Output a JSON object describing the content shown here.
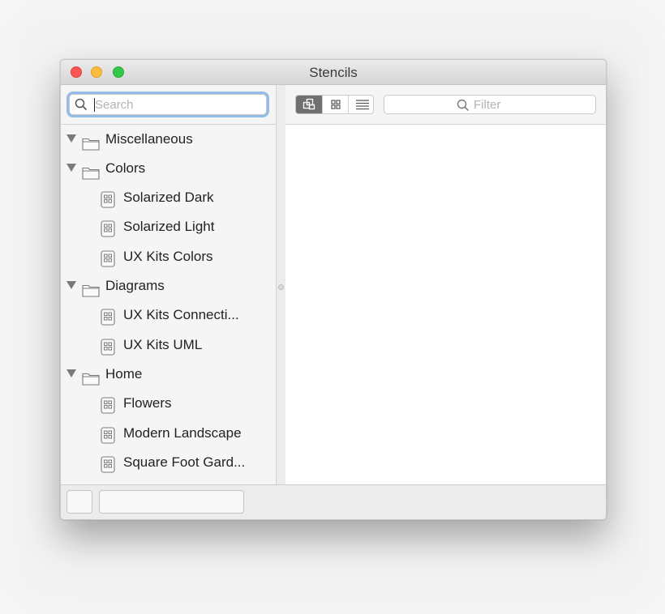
{
  "window": {
    "title": "Stencils"
  },
  "sidebar": {
    "search": {
      "placeholder": "Search",
      "value": ""
    },
    "tree": [
      {
        "type": "folder",
        "label": "Miscellaneous"
      },
      {
        "type": "folder",
        "label": "Colors"
      },
      {
        "type": "stencil",
        "label": "Solarized Dark"
      },
      {
        "type": "stencil",
        "label": "Solarized Light"
      },
      {
        "type": "stencil",
        "label": "UX Kits Colors"
      },
      {
        "type": "folder",
        "label": "Diagrams"
      },
      {
        "type": "stencil",
        "label": "UX Kits Connecti..."
      },
      {
        "type": "stencil",
        "label": "UX Kits UML"
      },
      {
        "type": "folder",
        "label": "Home"
      },
      {
        "type": "stencil",
        "label": "Flowers"
      },
      {
        "type": "stencil",
        "label": "Modern Landscape"
      },
      {
        "type": "stencil",
        "label": "Square Foot Gard..."
      }
    ]
  },
  "toolbar": {
    "view_modes": [
      {
        "icon": "stacked-squares-icon",
        "selected": true
      },
      {
        "icon": "grid-icon",
        "selected": false
      },
      {
        "icon": "list-icon",
        "selected": false
      }
    ],
    "filter": {
      "placeholder": "Filter",
      "value": ""
    }
  },
  "colors": {
    "close": "#fc5753",
    "minimize": "#fdbc40",
    "zoom": "#34c84a",
    "focus_ring": "#93bce9",
    "selected_segment": "#707070"
  }
}
